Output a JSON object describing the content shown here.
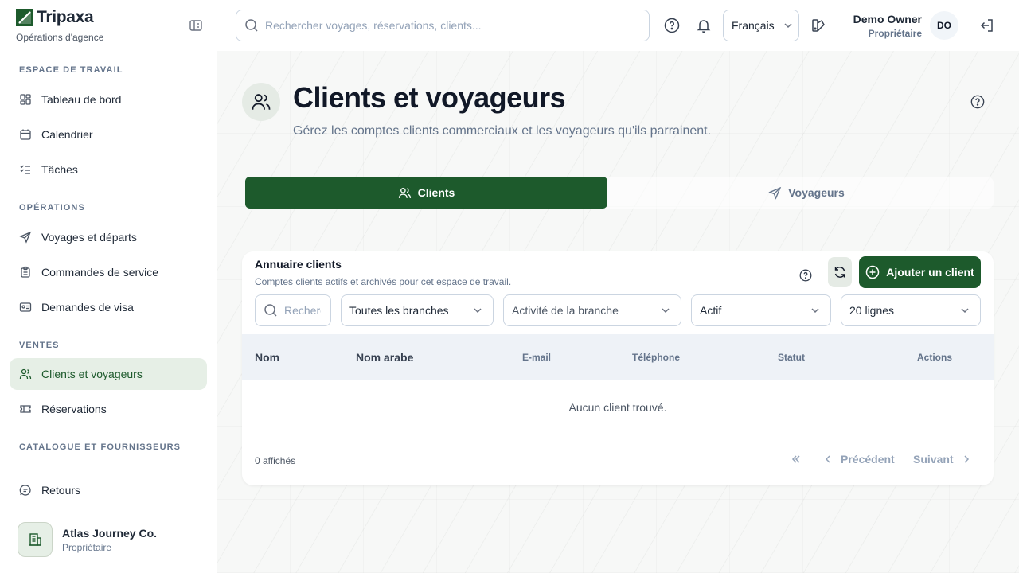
{
  "brand": {
    "name": "Tripaxa",
    "subtitle": "Opérations d'agence"
  },
  "sidebar": {
    "sections": [
      {
        "title": "ESPACE DE TRAVAIL"
      },
      {
        "title": "OPÉRATIONS"
      },
      {
        "title": "VENTES"
      },
      {
        "title": "CATALOGUE ET FOURNISSEURS"
      }
    ],
    "items": [
      {
        "label": "Tableau de bord",
        "icon": "dashboard-icon"
      },
      {
        "label": "Calendrier",
        "icon": "calendar-icon"
      },
      {
        "label": "Tâches",
        "icon": "tasks-icon"
      },
      {
        "label": "Voyages et départs",
        "icon": "send-icon"
      },
      {
        "label": "Commandes de service",
        "icon": "clipboard-icon"
      },
      {
        "label": "Demandes de visa",
        "icon": "id-card-icon"
      },
      {
        "label": "Clients et voyageurs",
        "icon": "users-icon",
        "active": true
      },
      {
        "label": "Réservations",
        "icon": "ticket-icon"
      },
      {
        "label": "Retours",
        "icon": "message-icon"
      }
    ],
    "org": {
      "name": "Atlas Journey Co.",
      "role": "Propriétaire"
    }
  },
  "topbar": {
    "search_placeholder": "Rechercher voyages, réservations, clients...",
    "language": "Français",
    "user_name": "Demo Owner",
    "user_role": "Propriétaire",
    "avatar_initials": "DO"
  },
  "page": {
    "title": "Clients et voyageurs",
    "subtitle": "Gérez les comptes clients commerciaux et les voyageurs qu'ils parrainent.",
    "tabs": [
      {
        "label": "Clients"
      },
      {
        "label": "Voyageurs"
      }
    ]
  },
  "card": {
    "title": "Annuaire clients",
    "subtitle": "Comptes clients actifs et archivés pour cet espace de travail.",
    "add_label": "Ajouter un client",
    "filters": {
      "search_placeholder": "Rechercher",
      "branch": "Toutes les branches",
      "activity": "Activité de la branche",
      "status": "Actif",
      "rows": "20 lignes"
    },
    "columns": [
      "Nom",
      "Nom arabe",
      "E-mail",
      "Téléphone",
      "Statut",
      "Actions"
    ],
    "empty_text": "Aucun client trouvé.",
    "count_text": "0 affichés",
    "prev_label": "Précédent",
    "next_label": "Suivant"
  },
  "colors": {
    "primary": "#1d5a2c",
    "active_bg": "#e6efe6",
    "muted": "#64748b"
  }
}
